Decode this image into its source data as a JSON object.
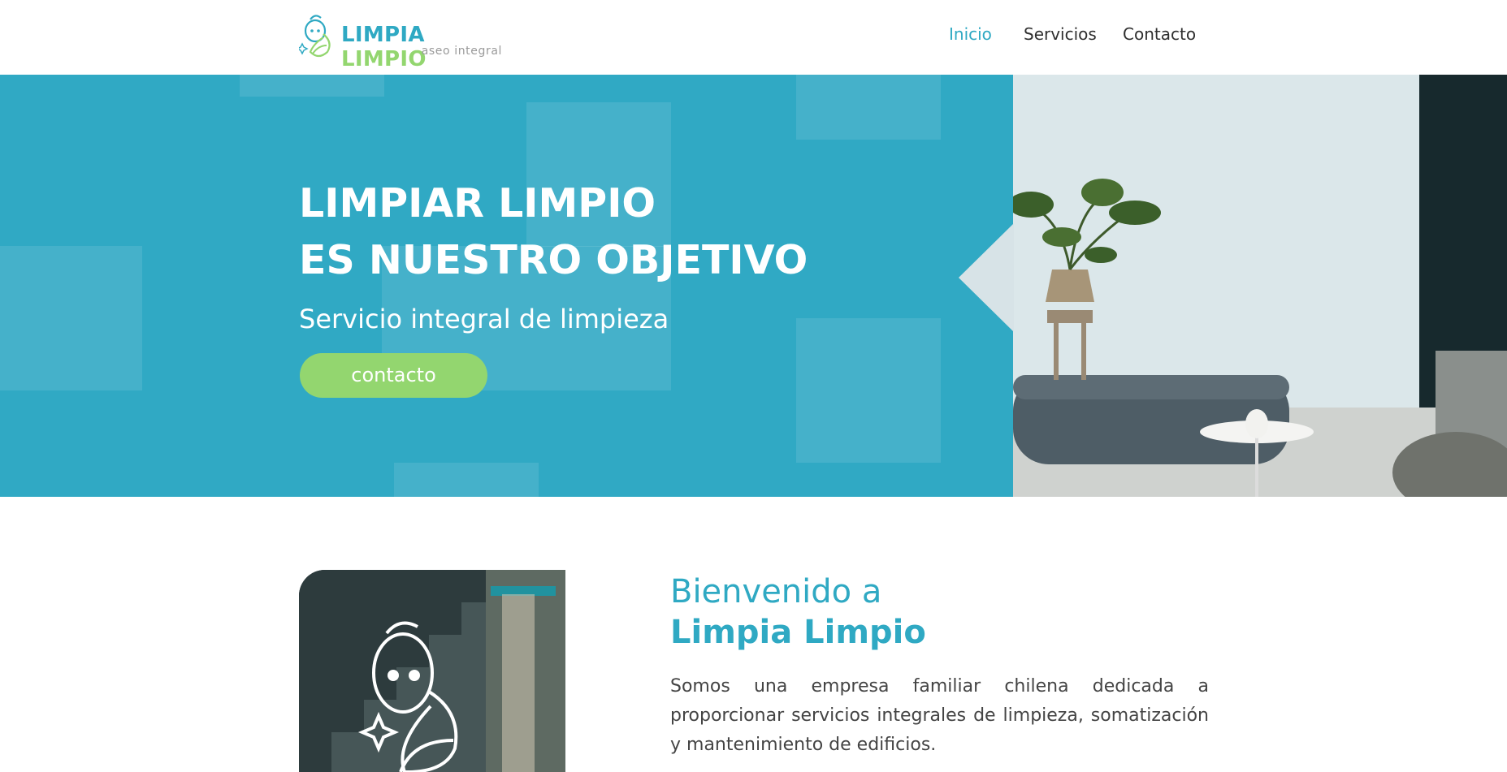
{
  "header": {
    "brand_part1": "LIMPIA",
    "brand_part2": "LIMPIO",
    "brand_tagline": "aseo integral",
    "nav": [
      {
        "label": "Inicio",
        "active": true
      },
      {
        "label": "Servicios",
        "active": false
      },
      {
        "label": "Contacto",
        "active": false
      }
    ]
  },
  "hero": {
    "title_line1": "LIMPIAR LIMPIO",
    "title_line2": "ES NUESTRO OBJETIVO",
    "subtitle": "Servicio integral de limpieza",
    "button_label": "contacto"
  },
  "welcome": {
    "heading_small": "Bienvenido a",
    "heading_big": "Limpia Limpio",
    "text": "Somos una empresa familiar chilena dedicada a proporcionar servicios integrales de limpieza, somatización y mantenimiento de edificios."
  },
  "colors": {
    "primary": "#2fa9c3",
    "accent": "#93d66f",
    "text": "#444444",
    "white": "#ffffff"
  },
  "icons": {
    "logo": "bee-mascot-icon",
    "welcome_image": "bee-outline-icon"
  }
}
